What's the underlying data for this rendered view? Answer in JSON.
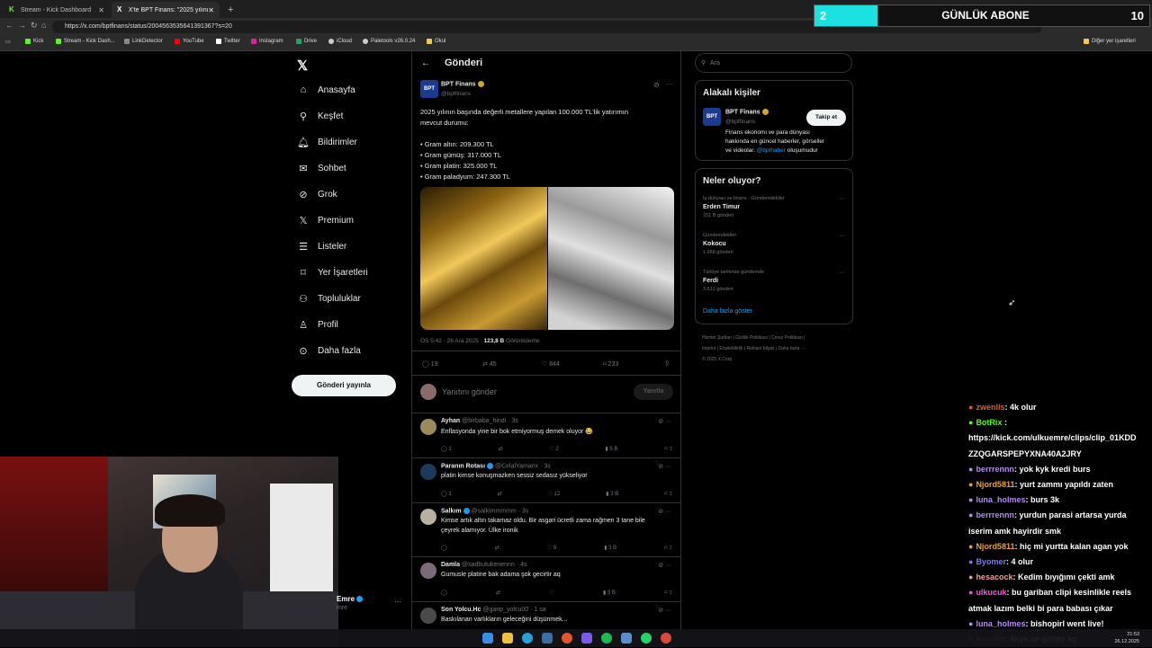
{
  "browser": {
    "tabs": [
      {
        "title": "Stream - Kick Dashboard"
      },
      {
        "title": "X'te BPT Finans: \"2025 yılının başın"
      }
    ],
    "url": "https://x.com/bptfinans/status/2004563535641391367?s=20",
    "bookmarks": [
      "Kick",
      "Stream - Kick Dash...",
      "LinkDetector",
      "YouTube",
      "Twitter",
      "Instagram",
      "Drive",
      "iCloud",
      "Paletools v26.0.24",
      "Okul"
    ],
    "other_bookmarks": "Diğer yer işaretleri"
  },
  "overlay": {
    "left_count": "2",
    "label": "GÜNLÜK ABONE",
    "right_count": "10"
  },
  "sidebar": {
    "items": [
      {
        "label": "Anasayfa",
        "icon": "home-icon"
      },
      {
        "label": "Keşfet",
        "icon": "search-icon"
      },
      {
        "label": "Bildirimler",
        "icon": "bell-icon"
      },
      {
        "label": "Sohbet",
        "icon": "mail-icon"
      },
      {
        "label": "Grok",
        "icon": "grok-icon"
      },
      {
        "label": "Premium",
        "icon": "x-icon"
      },
      {
        "label": "Listeler",
        "icon": "list-icon"
      },
      {
        "label": "Yer İşaretleri",
        "icon": "bookmark-icon"
      },
      {
        "label": "Topluluklar",
        "icon": "people-icon"
      },
      {
        "label": "Profil",
        "icon": "person-icon"
      },
      {
        "label": "Daha fazla",
        "icon": "more-icon"
      }
    ],
    "post_button": "Gönderi yayınla",
    "account_name": "Emre",
    "account_handle": "mre"
  },
  "main": {
    "header": "Gönderi",
    "tweet": {
      "name": "BPT Finans",
      "handle": "@bptfinans",
      "line1": "2025 yılının başında değerli metallere yapılan 100.000 TL'lik yatırımın",
      "line2": "mevcut durumu:",
      "bullets": [
        "• Gram altın: 209.300 TL",
        "• Gram gümüş: 317.000 TL",
        "• Gram platin: 325.000 TL",
        "• Gram paladyum: 247.300 TL"
      ],
      "time": "ÖS 5:42 · 26 Ara 2025 · ",
      "views": "123,8 B",
      "views_label": " Görüntüleme",
      "replies": "19",
      "retweets": "45",
      "likes": "844",
      "bookmarks": "233"
    },
    "reply_box": {
      "placeholder": "Yanıtını gönder",
      "button": "Yanıtla"
    },
    "replies": [
      {
        "name": "Ayhan",
        "handle": "@birbaba_hindi · 3s",
        "text": "Enflasyonda yine bir bok etmiyormuş demek oluyor 😂",
        "r": "1",
        "rt": "",
        "l": "2",
        "v": "5 B",
        "verified": false
      },
      {
        "name": "Paranın Rotası",
        "handle": "@CelalYamanx · 3s",
        "text": "platin kimse konuşmazken sessiz sedasız yükseliyor",
        "r": "1",
        "rt": "",
        "l": "12",
        "v": "3 B",
        "verified": true
      },
      {
        "name": "Salkım",
        "handle": "@salkimmmmm · 3s",
        "text": "Kimse artık altın takamaz oldu. Bir asgari ücretli zama rağmen 3 tane bile",
        "text2": "çeyrek alamıyor. Ülke ironik",
        "r": "",
        "rt": "",
        "l": "9",
        "v": "3 B",
        "verified": true
      },
      {
        "name": "Damla",
        "handle": "@sadbutukenennn · 4s",
        "text": "Gumusle platine bak adama şok gecirtir aq",
        "r": "",
        "rt": "",
        "l": "",
        "v": "3 B",
        "verified": false
      },
      {
        "name": "Son Yolcu.Hc",
        "handle": "@garip_yolcu00 · 1 sa",
        "text": "Baskılanan varlıkların geleceğini düşünmek...",
        "r": "",
        "rt": "",
        "l": "",
        "v": "",
        "verified": false
      }
    ]
  },
  "right": {
    "search_placeholder": "Ara",
    "related": {
      "title": "Alakalı kişiler",
      "name": "BPT Finans",
      "handle": "@bptfinans",
      "follow": "Takip et",
      "bio1": "Finans ekonomi ve para dünyası",
      "bio2": "hakkında en güncel haberler, görseller",
      "bio3_pre": "ve videolar. ",
      "bio3_link": "@bpthaber",
      "bio3_post": " oluşumudur"
    },
    "trends": {
      "title": "Neler oluyor?",
      "items": [
        {
          "category": "İş dünyası ve finans · Gündemdekiler",
          "topic": "Erden Timur",
          "count": "151 B gönderi"
        },
        {
          "category": "Gündemdekiler",
          "topic": "Kokocu",
          "count": "1.958 gönderi"
        },
        {
          "category": "Türkiye tarihinde gündemde",
          "topic": "Ferdi",
          "count": "3.612 gönderi"
        }
      ],
      "show_more": "Daha fazla göster"
    },
    "footer": [
      "Hizmet Şartları",
      "Gizlilik Politikası",
      "Çerez Politikası",
      "Imprint",
      "Erişilebilirlik",
      "Reklam bilgisi",
      "Daha fazla ···",
      "© 2025 X Corp."
    ]
  },
  "chat": [
    {
      "user": "zwenlis",
      "msg": ": 4k olur",
      "color": "#e05a2a"
    },
    {
      "user": "BotRix",
      "msg": " :",
      "color": "#53fc18"
    },
    {
      "user": "",
      "msg": "https://kick.com/ulkuemre/clips/clip_01KDD",
      "color": "#fff"
    },
    {
      "user": "",
      "msg": "ZZQGARSPEPYXNA40A2JRY",
      "color": "#fff"
    },
    {
      "user": "berrrennn",
      "msg": ": yok kyk kredi burs",
      "color": "#b48bf2"
    },
    {
      "user": "Njord5811",
      "msg": ": yurt zammı yapıldı zaten",
      "color": "#e8a23a"
    },
    {
      "user": "luna_holmes",
      "msg": ": burs 3k",
      "color": "#b48bf2"
    },
    {
      "user": "berrrennn",
      "msg": ": yurdun parasi artarsa yurda",
      "color": "#b48bf2"
    },
    {
      "user": "",
      "msg": "iserim amk hayirdir smk",
      "color": "#fff"
    },
    {
      "user": "Njord5811",
      "msg": ": hiç mi yurtta kalan agan yok",
      "color": "#e8a23a"
    },
    {
      "user": "Byomer",
      "msg": ": 4 olur",
      "color": "#7b7bf5"
    },
    {
      "user": "hesacock",
      "msg": ": Kedim bıyığımı çekti amk",
      "color": "#e7a0a0"
    },
    {
      "user": "ulkucuk",
      "msg": ": bu gariban clipi kesinlikle reels",
      "color": "#f05ad0"
    },
    {
      "user": "",
      "msg": "atmak lazım belki bi para babası çıkar",
      "color": "#fff"
    },
    {
      "user": "luna_holmes",
      "msg": ": bishopirl went live!",
      "color": "#b48bf2"
    },
    {
      "user": "zwenlis",
      "msg": ": 4kya ne geliyo aq",
      "color": "#e05a2a"
    }
  ],
  "clock": {
    "time": "21:53",
    "date": "26.12.2025"
  }
}
